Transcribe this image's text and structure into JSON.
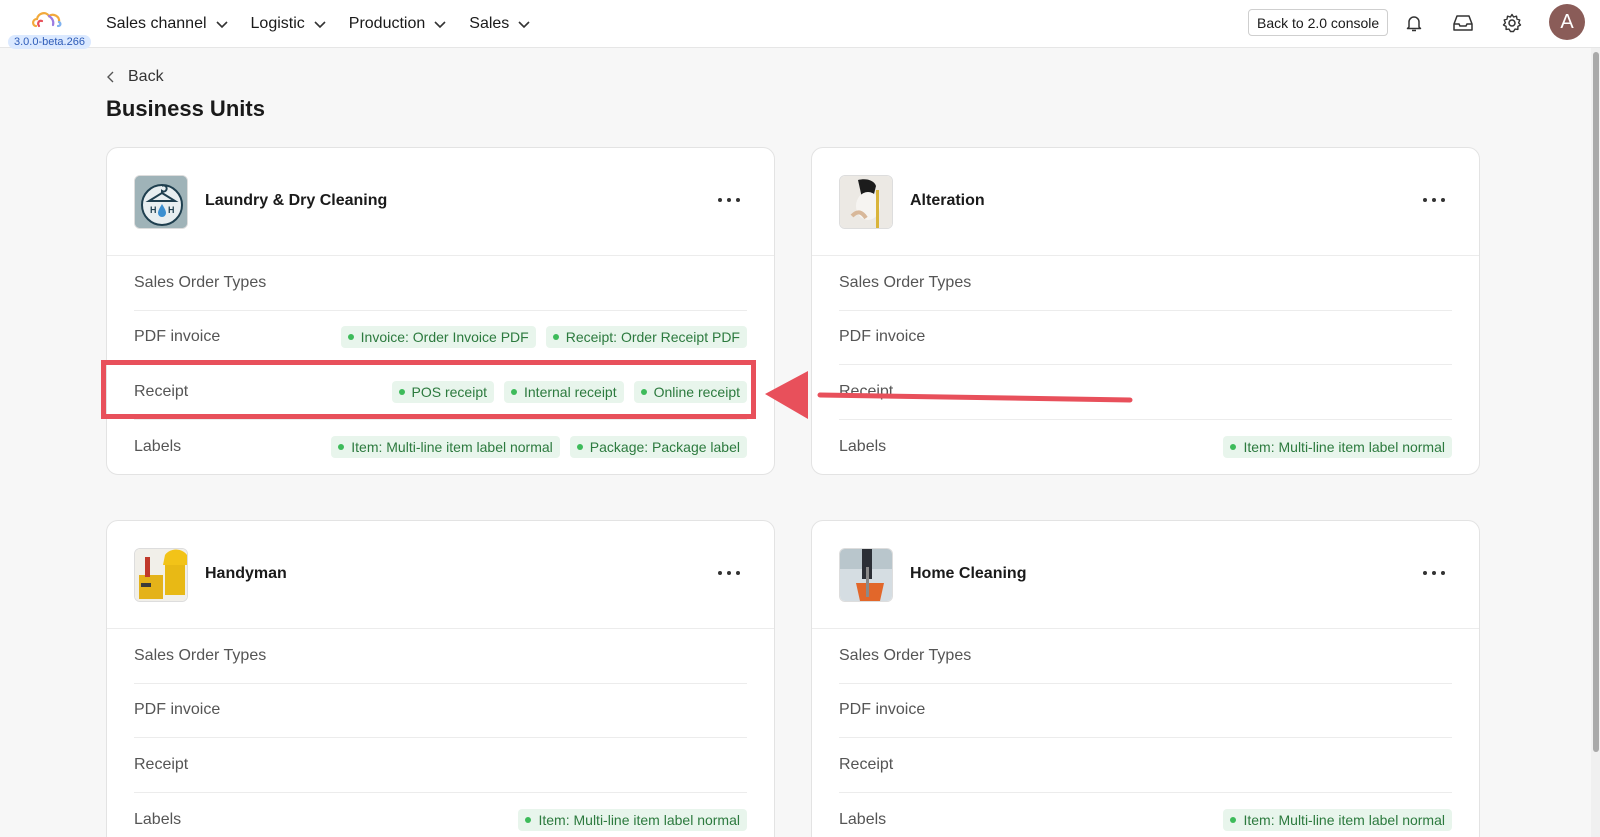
{
  "app": {
    "version": "3.0.0-beta.266",
    "brand_colors": [
      "#f2a93b",
      "#e8505b",
      "#7fb2f0",
      "#9c7be0"
    ]
  },
  "nav": [
    {
      "label": "Sales channel"
    },
    {
      "label": "Logistic"
    },
    {
      "label": "Production"
    },
    {
      "label": "Sales"
    }
  ],
  "header_actions": {
    "back_console_label": "Back to 2.0 console",
    "icons": [
      "bell-icon",
      "inbox-icon",
      "gear-icon"
    ],
    "avatar_initial": "A"
  },
  "page": {
    "back_label": "Back",
    "title": "Business Units"
  },
  "row_labels": {
    "sales_order_types": "Sales Order Types",
    "pdf_invoice": "PDF invoice",
    "receipt": "Receipt",
    "labels": "Labels"
  },
  "units": [
    {
      "name": "Laundry & Dry Cleaning",
      "icon": "laundry-logo",
      "sales_order_types": [],
      "pdf_invoice": [
        "Invoice: Order Invoice PDF",
        "Receipt: Order Receipt PDF"
      ],
      "receipt": [
        "POS receipt",
        "Internal receipt",
        "Online receipt"
      ],
      "labels": [
        "Item: Multi-line item label normal",
        "Package: Package label"
      ]
    },
    {
      "name": "Alteration",
      "icon": "alteration-photo",
      "sales_order_types": [],
      "pdf_invoice": [],
      "receipt": [],
      "labels": [
        "Item: Multi-line item label normal"
      ]
    },
    {
      "name": "Handyman",
      "icon": "handyman-photo",
      "sales_order_types": [],
      "pdf_invoice": [],
      "receipt": [],
      "labels": [
        "Item: Multi-line item label normal"
      ]
    },
    {
      "name": "Home Cleaning",
      "icon": "home-cleaning-photo",
      "sales_order_types": [],
      "pdf_invoice": [],
      "receipt": [],
      "labels": [
        "Item: Multi-line item label normal"
      ]
    }
  ],
  "annotation": {
    "color": "#e8505b"
  }
}
